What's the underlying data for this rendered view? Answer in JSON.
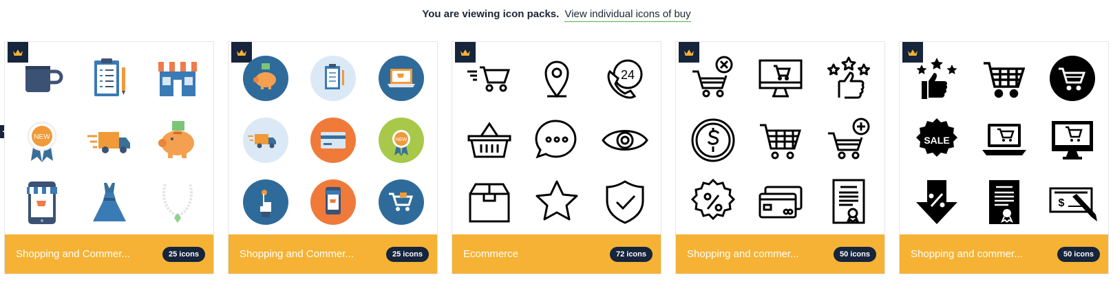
{
  "header": {
    "lead": "You are viewing icon packs.",
    "link": "View individual icons of buy"
  },
  "expand_button": "+",
  "colors": {
    "accent": "#f5b234",
    "navy": "#16243c",
    "link_underline": "#48b04a"
  },
  "cards": [
    {
      "title": "Shopping and Commer...",
      "count": "25 icons",
      "icons": [
        "mug-icon",
        "clipboard-icon",
        "storefront-icon",
        "new-badge-icon",
        "delivery-truck-icon",
        "piggy-bank-icon",
        "mobile-shop-icon",
        "dress-icon",
        "necklace-icon"
      ]
    },
    {
      "title": "Shopping and Commer...",
      "count": "25 icons",
      "icons": [
        "piggy-bank-circle-icon",
        "clipboard-circle-icon",
        "laptop-shop-circle-icon",
        "delivery-truck-circle-icon",
        "credit-card-circle-icon",
        "new-badge-circle-icon",
        "tap-finger-circle-icon",
        "mobile-shop-circle-icon",
        "shopping-cart-circle-icon"
      ]
    },
    {
      "title": "Ecommerce",
      "count": "72 icons",
      "icons": [
        "fast-cart-icon",
        "location-pin-icon",
        "support-24-icon",
        "basket-icon",
        "chat-bubble-icon",
        "eye-icon",
        "box-icon",
        "star-icon",
        "shield-check-icon"
      ]
    },
    {
      "title": "Shopping and commer...",
      "count": "50 icons",
      "icons": [
        "cart-remove-icon",
        "monitor-cart-icon",
        "thumbs-up-stars-icon",
        "dollar-coin-icon",
        "shopping-cart-icon",
        "cart-add-icon",
        "discount-badge-icon",
        "credit-cards-icon",
        "certificate-icon"
      ]
    },
    {
      "title": "Shopping and commer...",
      "count": "50 icons",
      "icons": [
        "thumbs-up-stars-icon",
        "shopping-cart-icon",
        "cart-circle-icon",
        "sale-badge-icon",
        "laptop-cart-icon",
        "monitor-cart-icon",
        "discount-arrow-icon",
        "certificate-icon",
        "cheque-pen-icon"
      ]
    }
  ]
}
